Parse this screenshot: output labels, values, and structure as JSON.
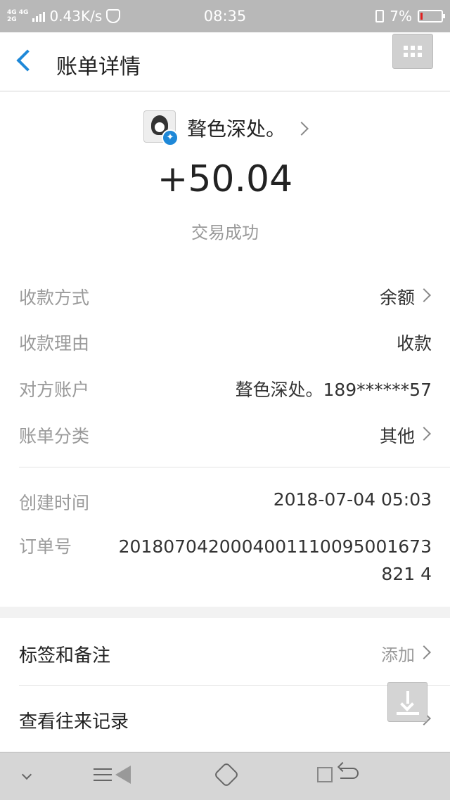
{
  "status_bar": {
    "network_top": "4G 4G",
    "network_bottom": "2G",
    "speed": "0.43K/s",
    "time": "08:35",
    "battery": "7%",
    "battery_level": 0.07
  },
  "header": {
    "title": "账单详情"
  },
  "transaction": {
    "counterparty": "聱色深处。",
    "amount": "+50.04",
    "status": "交易成功"
  },
  "details": [
    {
      "label": "收款方式",
      "value": "余额"
    },
    {
      "label": "收款理由",
      "value": "收款"
    },
    {
      "label": "对方账户",
      "value": "聱色深处。189******57"
    },
    {
      "label": "账单分类",
      "value": "其他"
    }
  ],
  "meta": {
    "created_label": "创建时间",
    "created_value": "2018-07-04 05:03",
    "order_label": "订单号",
    "order_value": "2018070420004001110095001673821 4"
  },
  "options": {
    "tags_label": "标签和备注",
    "tags_action": "添加",
    "history_label": "查看往来记录"
  },
  "colors": {
    "accent": "#1e88d8",
    "battery_low": "#e02020"
  }
}
